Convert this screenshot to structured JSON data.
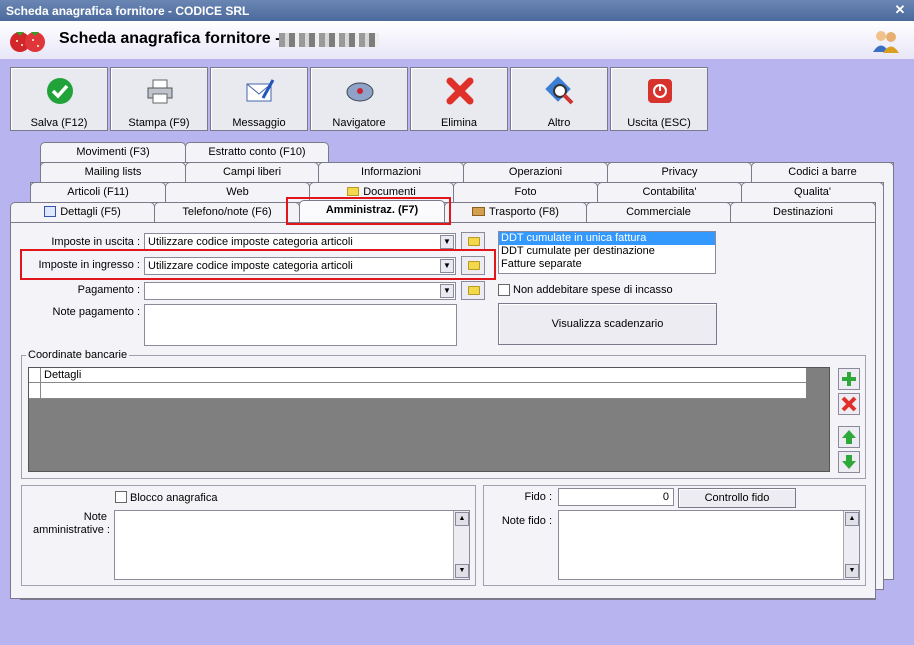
{
  "window": {
    "title": "Scheda anagrafica fornitore - CODICE SRL",
    "close_glyph": "✕"
  },
  "header": {
    "title": "Scheda anagrafica fornitore -",
    "logo_icon": "strawberry-icon",
    "users_icon": "users-icon"
  },
  "toolbar": [
    {
      "label": "Salva (F12)",
      "icon": "check-icon"
    },
    {
      "label": "Stampa (F9)",
      "icon": "printer-icon"
    },
    {
      "label": "Messaggio",
      "icon": "envelope-icon"
    },
    {
      "label": "Navigatore",
      "icon": "compass-icon"
    },
    {
      "label": "Elimina",
      "icon": "delete-x-icon"
    },
    {
      "label": "Altro",
      "icon": "magnifier-icon"
    },
    {
      "label": "Uscita (ESC)",
      "icon": "power-icon"
    }
  ],
  "tabs": {
    "row1": [
      "Movimenti (F3)",
      "Estratto conto (F10)"
    ],
    "row2": [
      "Mailing lists",
      "Campi liberi",
      "Informazioni",
      "Operazioni",
      "Privacy",
      "Codici a barre"
    ],
    "row3": [
      "Articoli (F11)",
      "Web",
      "Documenti",
      "Foto",
      "Contabilita'",
      "Qualita'"
    ],
    "row4": [
      "Dettagli (F5)",
      "Telefono/note (F6)",
      "Amministraz. (F7)",
      "Trasporto (F8)",
      "Commerciale",
      "Destinazioni"
    ]
  },
  "form": {
    "imposte_uscita_label": "Imposte in uscita :",
    "imposte_uscita_value": "Utilizzare codice imposte categoria articoli",
    "imposte_ingresso_label": "Imposte in ingresso :",
    "imposte_ingresso_value": "Utilizzare codice imposte categoria articoli",
    "pagamento_label": "Pagamento :",
    "pagamento_value": "",
    "note_pagamento_label": "Note pagamento :",
    "ddt_options": [
      "DDT cumulate in unica fattura",
      "DDT cumulate per destinazione",
      "Fatture separate"
    ],
    "non_addebitare_label": "Non addebitare spese di incasso",
    "visualizza_scadenzario": "Visualizza scadenzario"
  },
  "bank": {
    "title": "Coordinate bancarie",
    "column": "Dettagli"
  },
  "bottom_left": {
    "blocco_label": "Blocco anagrafica",
    "note_label_1": "Note",
    "note_label_2": "amministrative :"
  },
  "bottom_right": {
    "fido_label": "Fido :",
    "fido_value": "0",
    "controllo_fido": "Controllo fido",
    "note_fido_label": "Note fido :"
  },
  "highlight_color": "#e0161c"
}
